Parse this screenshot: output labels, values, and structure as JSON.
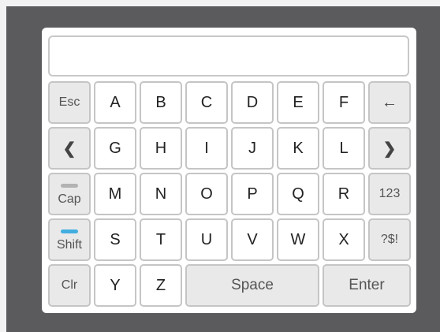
{
  "display": {
    "value": "",
    "placeholder": ""
  },
  "rows": {
    "row1": {
      "esc": "Esc",
      "k1": "A",
      "k2": "B",
      "k3": "C",
      "k4": "D",
      "k5": "E",
      "k6": "F",
      "backspace": "←"
    },
    "row2": {
      "left": "❮",
      "k1": "G",
      "k2": "H",
      "k3": "I",
      "k4": "J",
      "k5": "K",
      "k6": "L",
      "right": "❯"
    },
    "row3": {
      "cap": "Cap",
      "k1": "M",
      "k2": "N",
      "k3": "O",
      "k4": "P",
      "k5": "Q",
      "k6": "R",
      "num": "123"
    },
    "row4": {
      "shift": "Shift",
      "k1": "S",
      "k2": "T",
      "k3": "U",
      "k4": "V",
      "k5": "W",
      "k6": "X",
      "sym": "?$!"
    },
    "row5": {
      "clr": "Clr",
      "k1": "Y",
      "k2": "Z",
      "space": "Space",
      "enter": "Enter"
    }
  },
  "state": {
    "caps_lock_on": false,
    "shift_on": true
  },
  "colors": {
    "indicator_on": "#42aee0",
    "indicator_off": "#b3b3b3",
    "frame": "#5b5b5e"
  }
}
